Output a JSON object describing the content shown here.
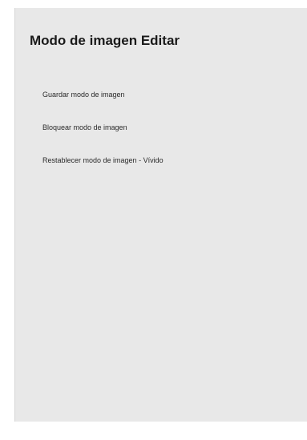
{
  "panel": {
    "title": "Modo de imagen Editar",
    "items": [
      {
        "label": "Guardar modo de imagen"
      },
      {
        "label": "Bloquear modo de imagen"
      },
      {
        "label": "Restablecer modo de imagen - Vívido"
      }
    ]
  }
}
